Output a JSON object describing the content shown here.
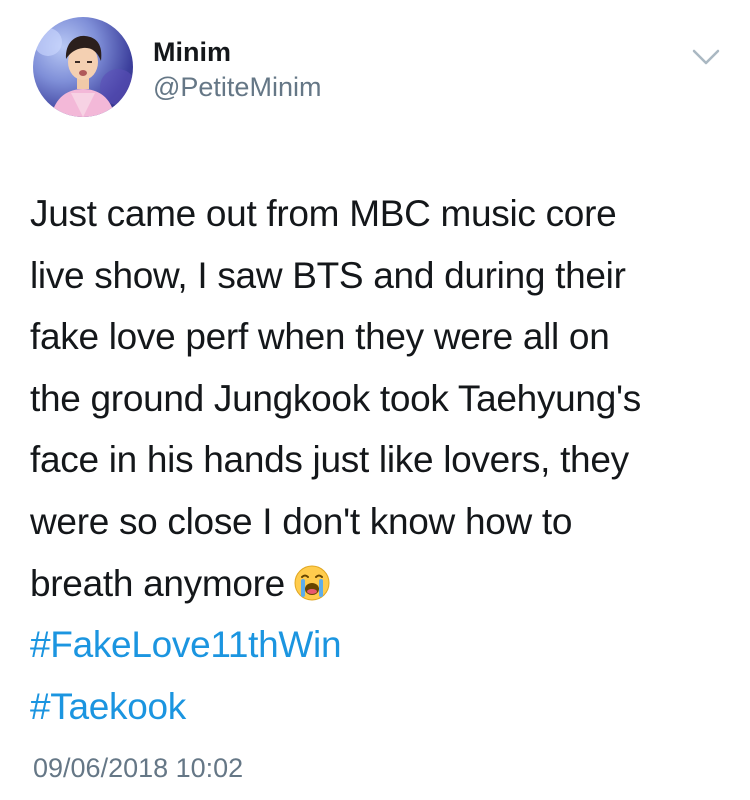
{
  "tweet": {
    "author": {
      "display_name": "Minim",
      "handle": "@PetiteMinim"
    },
    "body_lines": [
      "Just came out from MBC music core",
      "live show, I saw BTS and during their",
      "fake love perf when they were all on",
      "the ground Jungkook took Taehyung's",
      "face in his hands just like lovers, they",
      "were so close I don't know how to",
      "breath anymore"
    ],
    "emoji": "loudly-crying-face",
    "hashtags": [
      "#FakeLove11thWin",
      "#Taekook"
    ],
    "timestamp": "09/06/2018 10:02",
    "colors": {
      "text": "#14171a",
      "secondary": "#657786",
      "hashtag": "#1b95e0"
    },
    "icons": {
      "menu": "chevron-down-icon",
      "avatar": "profile-photo"
    }
  }
}
